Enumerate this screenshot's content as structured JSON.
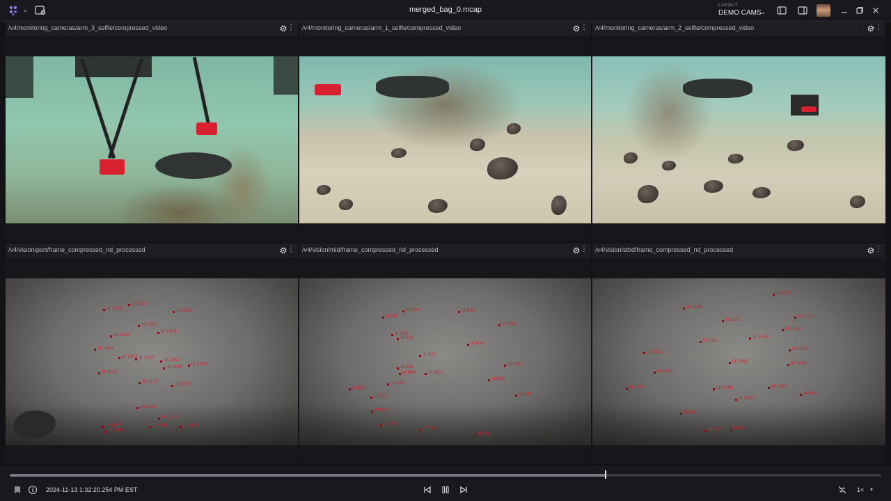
{
  "app": {
    "title": "merged_bag_0.mcap",
    "layout_caption": "LAYOUT",
    "layout_name": "DEMO CAMS",
    "colors": {
      "accent": "#7b6fd6",
      "detection": "#d0202c",
      "background": "#121217"
    }
  },
  "panels": [
    {
      "topic": "/v4/monitoring_cameras/arm_3_selfie/compressed_video"
    },
    {
      "topic": "/v4/monitoring_cameras/arm_1_selfie/compressed_video"
    },
    {
      "topic": "/v4/monitoring_cameras/arm_2_selfie/compressed_video"
    },
    {
      "topic": "/v4/vision/port/frame_compressed_nd_processed"
    },
    {
      "topic": "/v4/vision/mid/frame_compressed_nd_processed"
    },
    {
      "topic": "/v4/vision/stbd/frame_compressed_nd_processed"
    }
  ],
  "detections": {
    "port": [
      "id 1303",
      "id 1351",
      "id 1365",
      "id 1317",
      "id 1314",
      "id 1290",
      "id 1264",
      "id 1243",
      "id 1237",
      "id 1262",
      "id 1260",
      "id 1258",
      "id 1215",
      "id 1171",
      "id 1170",
      "id 1114",
      "id 1138",
      "id 1185",
      "id 1167",
      "id 1169",
      "id 1176"
    ],
    "mid": [
      "id 995",
      "id 984",
      "id 992",
      "id 968",
      "id 965",
      "id 958",
      "id 926",
      "id 917",
      "id 904",
      "id 899",
      "id 889",
      "id 885",
      "id 869",
      "id 867",
      "id 859",
      "id 851",
      "id 846",
      "id 838",
      "id 836",
      "id 796",
      "id 781"
    ],
    "stbd": [
      "id 1173",
      "id 1168",
      "id 1177",
      "id 1157",
      "id 1149",
      "id 1125",
      "id 1121",
      "id 1116",
      "id 1111",
      "id 1082",
      "id 1072",
      "id 1069",
      "id 1052",
      "id 1038",
      "id 1020",
      "id 1007",
      "id 990",
      "id 961",
      "id 947",
      "id 932"
    ]
  },
  "playback": {
    "timestamp": "2024-11-13 1:32:20.254 PM EST",
    "progress": 0.684,
    "speed": "1×"
  }
}
